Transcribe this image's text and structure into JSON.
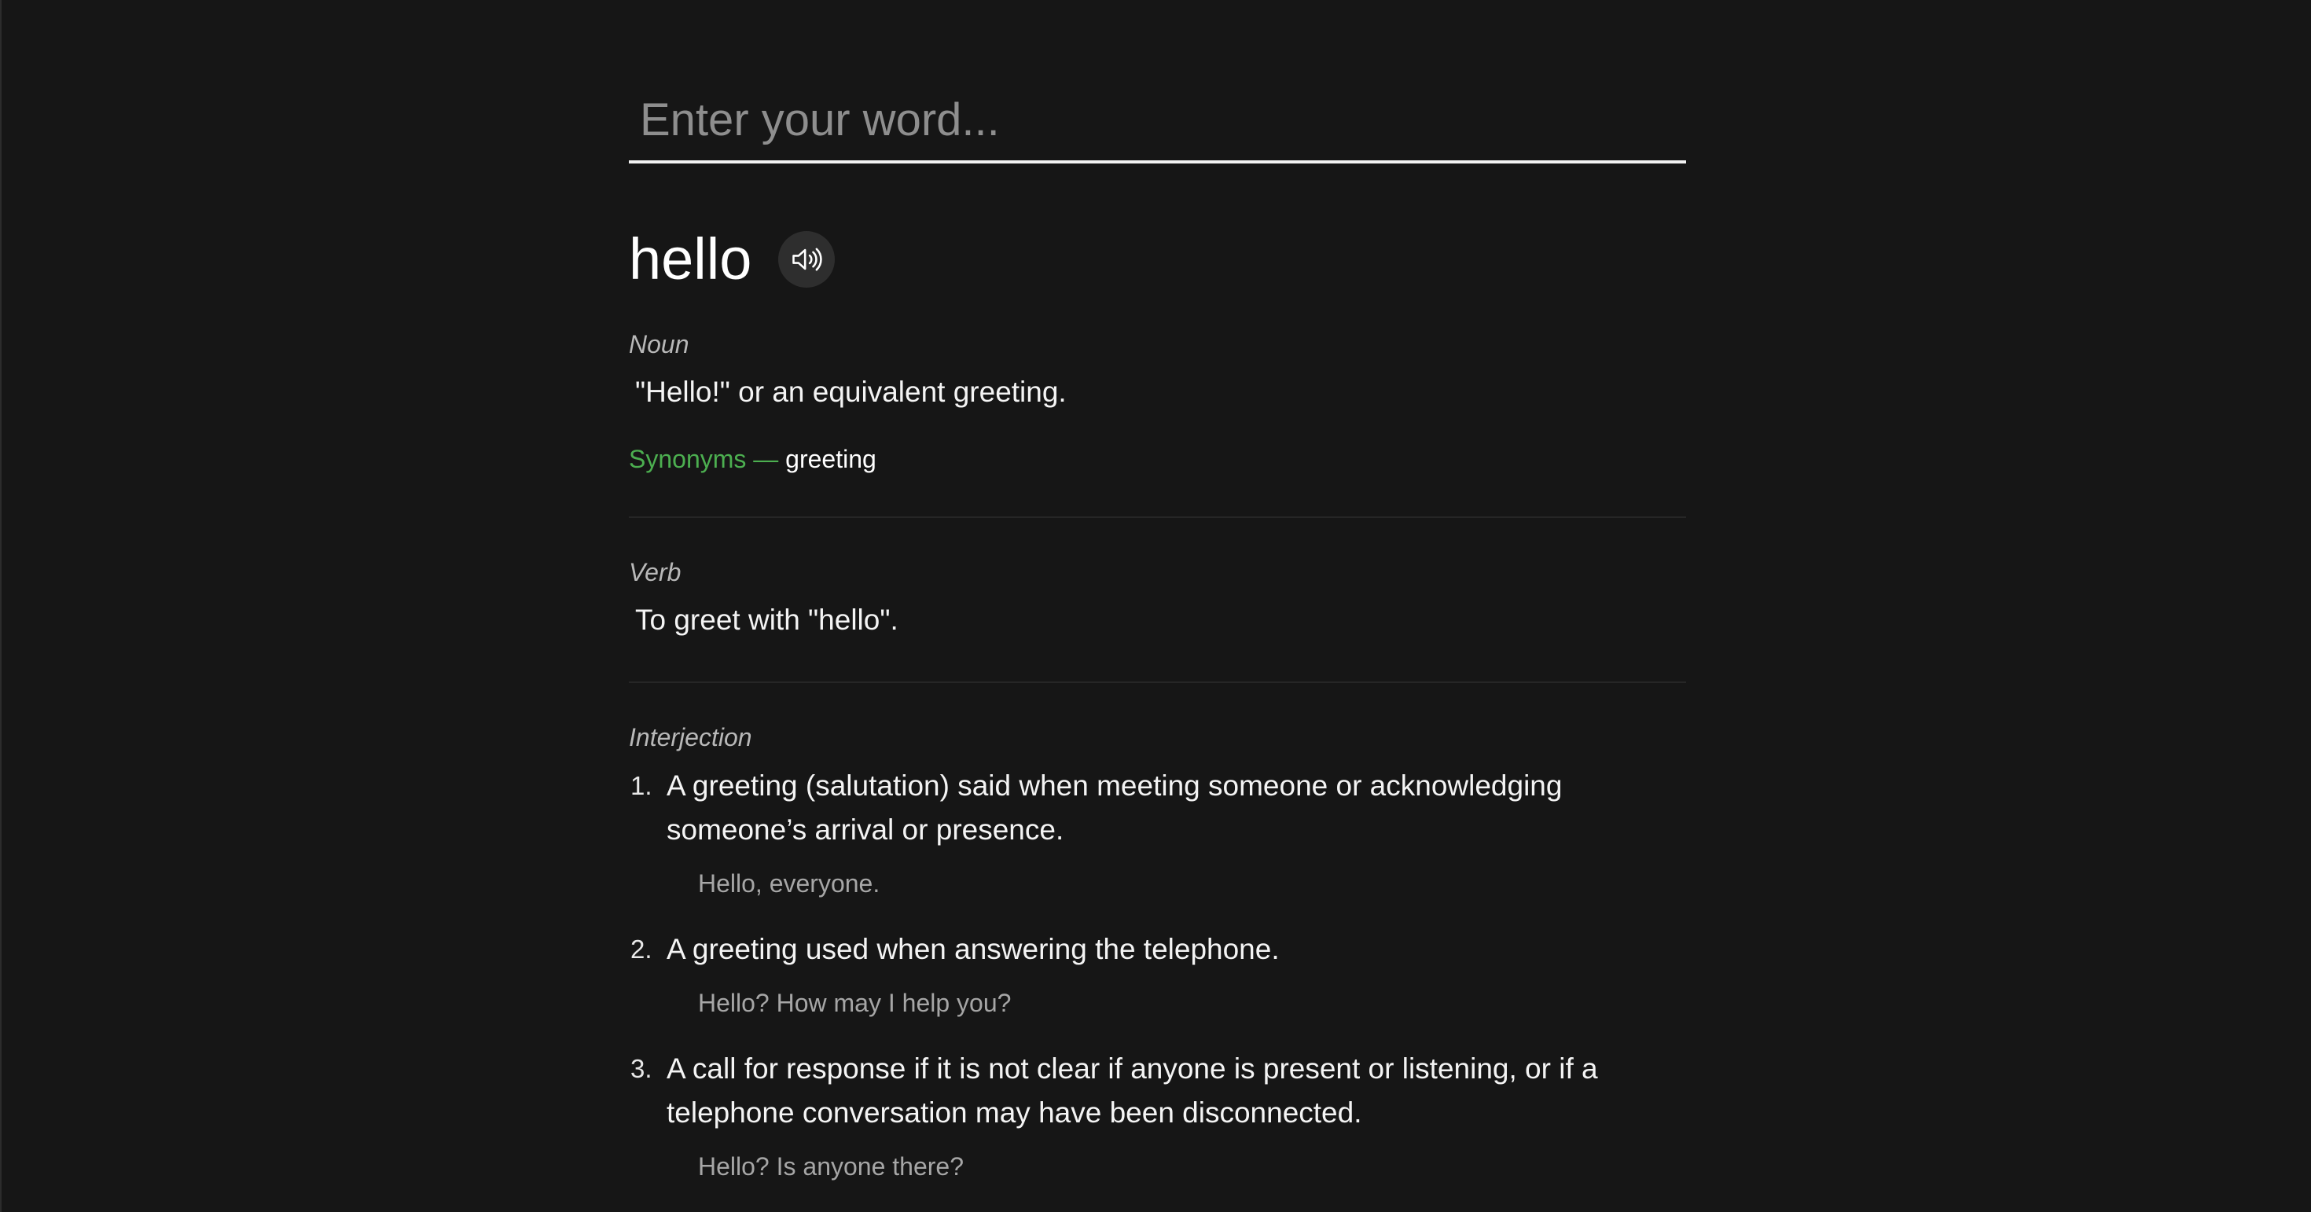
{
  "search": {
    "placeholder": "Enter your word...",
    "value": ""
  },
  "entry": {
    "word": "hello",
    "audio_icon": "speaker-icon",
    "meanings": [
      {
        "part_of_speech": "Noun",
        "definition": "\"Hello!\" or an equivalent greeting.",
        "synonyms_label": "Synonyms —",
        "synonyms": "greeting"
      },
      {
        "part_of_speech": "Verb",
        "definition": "To greet with \"hello\"."
      },
      {
        "part_of_speech": "Interjection",
        "definitions": [
          {
            "number": "1.",
            "text": "A greeting (salutation) said when meeting someone or acknowledging someone’s arrival or presence.",
            "example": "Hello, everyone."
          },
          {
            "number": "2.",
            "text": "A greeting used when answering the telephone.",
            "example": "Hello? How may I help you?"
          },
          {
            "number": "3.",
            "text": "A call for response if it is not clear if anyone is present or listening, or if a telephone conversation may have been disconnected.",
            "example": "Hello? Is anyone there?"
          }
        ]
      }
    ]
  },
  "colors": {
    "background": "#161616",
    "accent_synonym": "#4caf50",
    "text": "#ffffff",
    "muted": "#a6a6a6"
  }
}
